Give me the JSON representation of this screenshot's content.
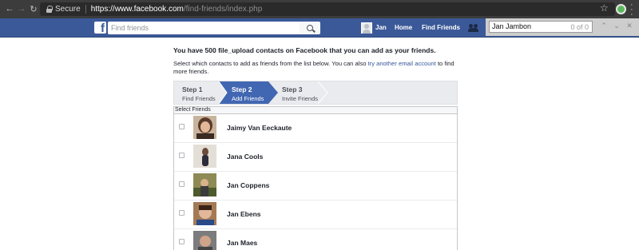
{
  "browser": {
    "secure_label": "Secure",
    "url_host": "https://www.facebook.com",
    "url_path": "/find-friends/index.php"
  },
  "fbbar": {
    "logo": "f",
    "search_placeholder": "Find friends",
    "user_name": "Jan",
    "home_label": "Home",
    "find_friends_label": "Find Friends"
  },
  "findbar": {
    "query": "Jan Jambon",
    "count": "0 of 0"
  },
  "main": {
    "heading": "You have 500 file_upload contacts on Facebook that you can add as your friends.",
    "desc_pre": "Select which contacts to add as friends from the list below. You can also ",
    "desc_link": "try another email account",
    "desc_post": " to find more friends."
  },
  "steps": [
    {
      "title": "Step 1",
      "subtitle": "Find Friends",
      "active": false
    },
    {
      "title": "Step 2",
      "subtitle": "Add Friends",
      "active": true
    },
    {
      "title": "Step 3",
      "subtitle": "Invite Friends",
      "active": false
    }
  ],
  "list": {
    "header": "Select Friends",
    "contacts": [
      {
        "name": "Jaimy Van Eeckaute",
        "photo_color": "#6b4a3a"
      },
      {
        "name": "Jana Cools",
        "photo_color": "#c9b9a6"
      },
      {
        "name": "Jan Coppens",
        "photo_color": "#8a7a4c"
      },
      {
        "name": "Jan Ebens",
        "photo_color": "#5d3b2a"
      },
      {
        "name": "Jan Maes",
        "photo_color": "#6b6b6b"
      }
    ]
  }
}
